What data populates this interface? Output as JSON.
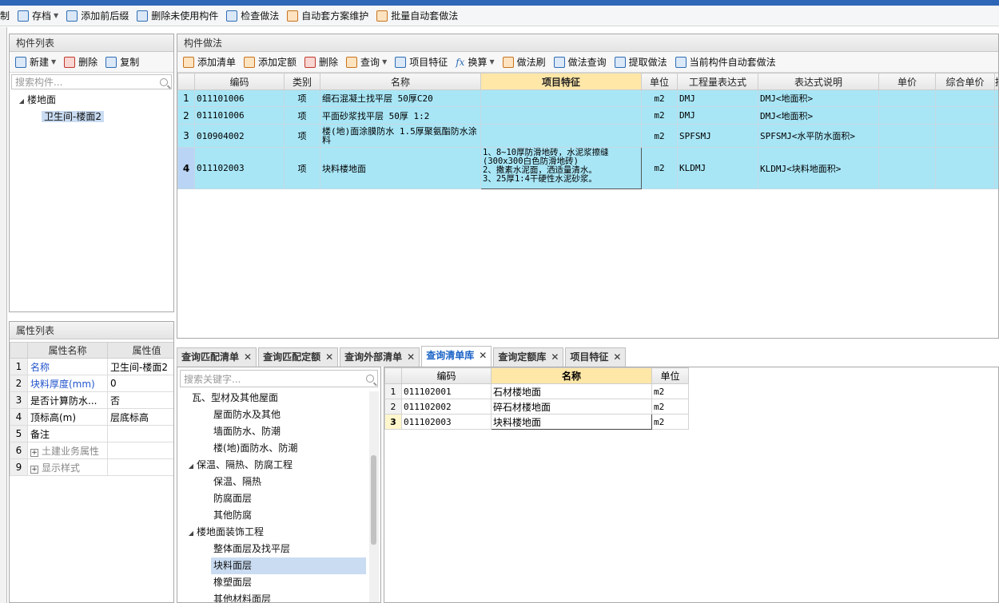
{
  "main_toolbar": {
    "items": [
      {
        "label": "制",
        "icon": "none"
      },
      {
        "label": "存档",
        "icon": "archive-icon",
        "dropdown": true
      },
      {
        "label": "添加前后缀",
        "icon": "prefix-icon"
      },
      {
        "label": "删除未使用构件",
        "icon": "delete-unused-icon"
      },
      {
        "label": "检查做法",
        "icon": "check-icon"
      },
      {
        "label": "自动套方案维护",
        "icon": "auto-scheme-icon"
      },
      {
        "label": "批量自动套做法",
        "icon": "batch-auto-icon"
      }
    ]
  },
  "component_list": {
    "title": "构件列表",
    "toolbar": {
      "new": "新建",
      "delete": "删除",
      "copy": "复制"
    },
    "search_placeholder": "搜索构件...",
    "tree": {
      "parent": "楼地面",
      "child": "卫生间-楼面2"
    }
  },
  "attr_list": {
    "title": "属性列表",
    "headers": {
      "name": "属性名称",
      "value": "属性值"
    },
    "rows": [
      {
        "num": "1",
        "name": "名称",
        "value": "卫生间-楼面2"
      },
      {
        "num": "2",
        "name": "块料厚度(mm)",
        "value": "0"
      },
      {
        "num": "3",
        "name": "是否计算防水...",
        "value": "否"
      },
      {
        "num": "4",
        "name": "顶标高(m)",
        "value": "层底标高"
      },
      {
        "num": "5",
        "name": "备注",
        "value": ""
      },
      {
        "num": "6",
        "name": "土建业务属性",
        "value": ""
      },
      {
        "num": "9",
        "name": "显示样式",
        "value": ""
      }
    ]
  },
  "method_panel": {
    "title": "构件做法",
    "toolbar": [
      "添加清单",
      "添加定额",
      "删除",
      "查询",
      "项目特征",
      "换算",
      "做法刷",
      "做法查询",
      "提取做法",
      "当前构件自动套做法"
    ],
    "headers": [
      "编码",
      "类别",
      "名称",
      "项目特征",
      "单位",
      "工程量表达式",
      "表达式说明",
      "单价",
      "综合单价",
      "措"
    ],
    "rows": [
      {
        "num": "1",
        "code": "011101006",
        "type": "项",
        "name": "细石混凝土找平层 50厚C20",
        "feature": "",
        "unit": "m2",
        "expr": "DMJ",
        "desc": "DMJ<地面积>",
        "price": "",
        "total": ""
      },
      {
        "num": "2",
        "code": "011101006",
        "type": "项",
        "name": "平面砂浆找平层 50厚 1:2",
        "feature": "",
        "unit": "m2",
        "expr": "DMJ",
        "desc": "DMJ<地面积>",
        "price": "",
        "total": ""
      },
      {
        "num": "3",
        "code": "010904002",
        "type": "项",
        "name": "楼(地)面涂膜防水 1.5厚聚氨酯防水涂料",
        "feature": "",
        "unit": "m2",
        "expr": "SPFSMJ",
        "desc": "SPFSMJ<水平防水面积>",
        "price": "",
        "total": ""
      },
      {
        "num": "4",
        "code": "011102003",
        "type": "项",
        "name": "块料楼地面",
        "feature": "1、8~10厚防滑地砖，水泥浆擦缝(300x300白色防滑地砖)\n2、撒素水泥面，洒适量清水。\n3、25厚1:4干硬性水泥砂浆。",
        "unit": "m2",
        "expr": "KLDMJ",
        "desc": "KLDMJ<块料地面积>",
        "price": "",
        "total": ""
      }
    ]
  },
  "bottom_tabs": [
    {
      "label": "查询匹配清单",
      "active": false
    },
    {
      "label": "查询匹配定额",
      "active": false
    },
    {
      "label": "查询外部清单",
      "active": false
    },
    {
      "label": "查询清单库",
      "active": true
    },
    {
      "label": "查询定额库",
      "active": false
    },
    {
      "label": "项目特征",
      "active": false
    }
  ],
  "library_tree": {
    "search_placeholder": "搜索关键字...",
    "nodes": [
      {
        "label": "瓦、型材及其他屋面",
        "level": 2
      },
      {
        "label": "屋面防水及其他",
        "level": 2
      },
      {
        "label": "墙面防水、防潮",
        "level": 2
      },
      {
        "label": "楼(地)面防水、防潮",
        "level": 2
      },
      {
        "label": "保温、隔热、防腐工程",
        "level": 1
      },
      {
        "label": "保温、隔热",
        "level": 2
      },
      {
        "label": "防腐面层",
        "level": 2
      },
      {
        "label": "其他防腐",
        "level": 2
      },
      {
        "label": "楼地面装饰工程",
        "level": 1
      },
      {
        "label": "整体面层及找平层",
        "level": 2
      },
      {
        "label": "块料面层",
        "level": 2,
        "selected": true
      },
      {
        "label": "橡塑面层",
        "level": 2
      },
      {
        "label": "其他材料面层",
        "level": 2
      }
    ]
  },
  "library_table": {
    "headers": [
      "编码",
      "名称",
      "单位"
    ],
    "rows": [
      {
        "num": "1",
        "code": "011102001",
        "name": "石材楼地面",
        "unit": "m2"
      },
      {
        "num": "2",
        "code": "011102002",
        "name": "碎石材楼地面",
        "unit": "m2"
      },
      {
        "num": "3",
        "code": "011102003",
        "name": "块料楼地面",
        "unit": "m2"
      }
    ]
  }
}
